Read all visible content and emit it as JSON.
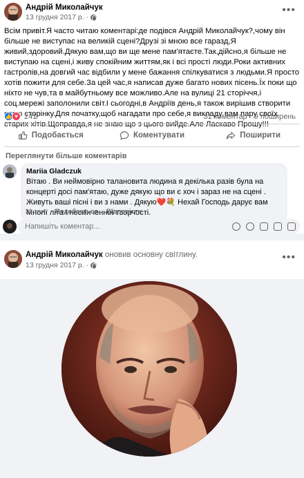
{
  "post1": {
    "author": "Андрій Миколайчук",
    "date": "13 грудня 2017 р. ·",
    "text": "Всім привіт.Я часто читаю коментарі:де подівся Андрій Миколайчук?,чому він більше не виступає на великій сцені?Друзі зі мною все гаразд,Я живий,здоровий.Дякую вам,що ви ще мене пам'ятаєте.Так,дійсно,я більше не виступаю на сцені,і живу спокійним життям,як і всі прості люди.Роки активних гастролів,на довгий час відбили у мене бажання спілкуватися з людьми.Я просто хотів пожити для себе.За цей час,я написав дуже багато нових пісень.Їх поки що ніхто не чув,та в майбутньому все можливо.Але на вулиці 21 сторіччя,і соц.мережі заполонили світ.І сьогодні,в Андріїв день,я також вирішив створити свою сторінку.Для початку,щоб нагадати про себе,я викладу вам пару своїх старих хітів.Щоправда,я не знаю що з цього вийде.Але Ласкаво Прошу!!!",
    "reaction_count": "241",
    "comments_count": "31 коментар",
    "shares_count": "9 поширень",
    "actions": {
      "like": "Подобається",
      "comment": "Коментувати",
      "share": "Поширити"
    },
    "view_more_comments": "Переглянути більше коментарів",
    "comment": {
      "author": "Mariia Gladczuk",
      "text": "Вітаю . Ви неймовірно талановита людина я декілька разів була на концерті досі пам'ятаю, дуже дякую що ви є хоч і зараз не на сцені . Живуть ваші пісні і ви з нами . Дякую❤️💐 Нехай Господь дарує вам Многії літа і нескінченної творчості.",
      "time": "10 тиж.",
      "like": "Подобається",
      "reply": "Відповісти"
    },
    "compose_placeholder": "Напишіть коментар..."
  },
  "post2": {
    "author": "Андрій Миколайчук",
    "action": " оновив основну світлину.",
    "date": "13 грудня 2017 р. ·"
  },
  "colors": {
    "accent": "#1877f2",
    "love": "#f33e58",
    "secondary_text": "#65676b"
  }
}
